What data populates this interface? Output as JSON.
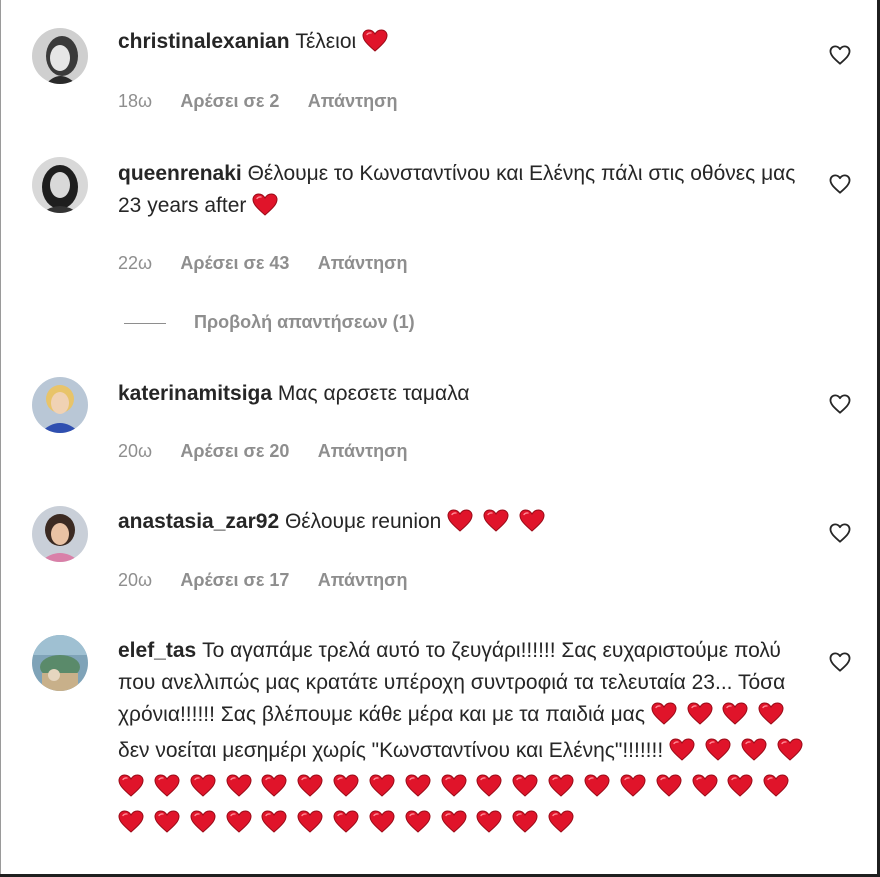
{
  "comments": [
    {
      "username": "christinalexanian",
      "text": "Τέλειοι",
      "hearts": 1,
      "time": "18ω",
      "likes": "Αρέσει σε 2",
      "reply": "Απάντηση"
    },
    {
      "username": "queenrenaki",
      "text": "Θέλουμε το Κωνσταντίνου και Ελένης πάλι στις οθόνες μας 23 years after",
      "hearts": 1,
      "time": "22ω",
      "likes": "Αρέσει σε 43",
      "reply": "Απάντηση"
    },
    {
      "username": "katerinamitsiga",
      "text": "Μας αρεσετε ταμαλα",
      "hearts": 0,
      "time": "20ω",
      "likes": "Αρέσει σε 20",
      "reply": "Απάντηση"
    },
    {
      "username": "anastasia_zar92",
      "text": "Θέλουμε reunion",
      "hearts": 3,
      "time": "20ω",
      "likes": "Αρέσει σε 17",
      "reply": "Απάντηση"
    },
    {
      "username": "elef_tas",
      "text": "Το αγαπάμε τρελά αυτό το ζευγάρι!!!!!! Σας ευχαριστούμε πολύ που ανελλιπώς μας κρατάτε υπέροχη συντροφιά τα τελευταία 23... Τόσα χρόνια!!!!!! Σας βλέπουμε κάθε μέρα και με τα παιδιά μας",
      "hearts_mid": 4,
      "text2": "δεν νοείται μεσημέρι χωρίς \"Κωνσταντίνου και Ελένης\"!!!!!!!",
      "hearts": 36
    }
  ],
  "view_replies": "Προβολή απαντήσεων (1)",
  "colors": {
    "heart": "#e0142a",
    "meta": "#8e8e8e",
    "text": "#262626"
  },
  "icons": {
    "like": "heart-outline-icon",
    "emoji": "red-heart-emoji"
  }
}
